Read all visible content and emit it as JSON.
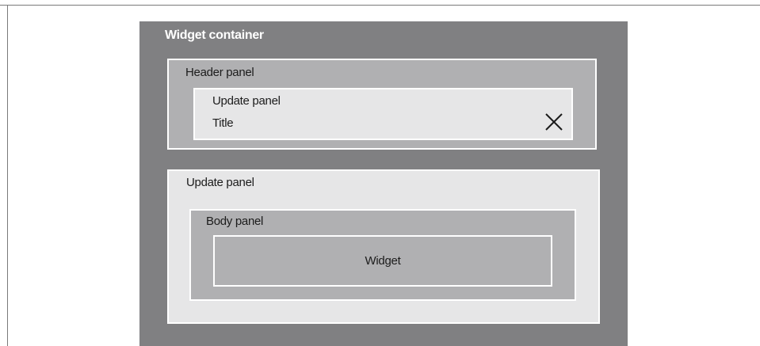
{
  "diagram": {
    "container_label": "Widget container",
    "header_panel": {
      "label": "Header panel",
      "update_panel": {
        "label": "Update panel",
        "title": "Title",
        "close_icon": "close-icon"
      }
    },
    "update_panel": {
      "label": "Update panel",
      "body_panel": {
        "label": "Body panel",
        "widget_label": "Widget"
      }
    }
  }
}
